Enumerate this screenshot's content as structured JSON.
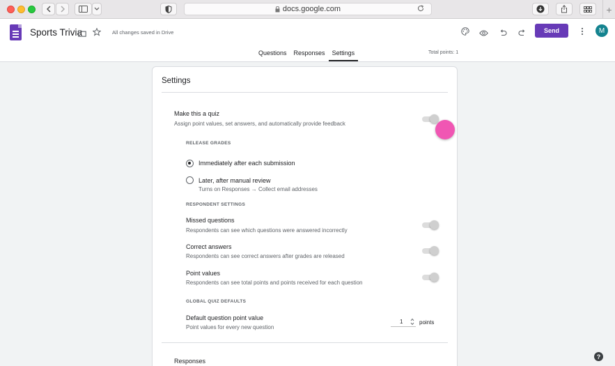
{
  "browser": {
    "url": "docs.google.com"
  },
  "app": {
    "title": "Sports Trivia",
    "saved_status": "All changes saved in Drive",
    "send_label": "Send",
    "avatar_initial": "M",
    "tabs": [
      {
        "label": "Questions"
      },
      {
        "label": "Responses"
      },
      {
        "label": "Settings"
      }
    ],
    "total_points": "Total points: 1"
  },
  "settings": {
    "title": "Settings",
    "quiz": {
      "label": "Make this a quiz",
      "desc": "Assign point values, set answers, and automatically provide feedback"
    },
    "release_grades": {
      "heading": "RELEASE GRADES",
      "options": [
        {
          "label": "Immediately after each submission",
          "selected": true
        },
        {
          "label": "Later, after manual review",
          "desc": "Turns on Responses → Collect email addresses",
          "selected": false
        }
      ]
    },
    "respondent_settings": {
      "heading": "RESPONDENT SETTINGS",
      "items": [
        {
          "label": "Missed questions",
          "desc": "Respondents can see which questions were answered incorrectly"
        },
        {
          "label": "Correct answers",
          "desc": "Respondents can see correct answers after grades are released"
        },
        {
          "label": "Point values",
          "desc": "Respondents can see total points and points received for each question"
        }
      ]
    },
    "global_defaults": {
      "heading": "GLOBAL QUIZ DEFAULTS",
      "point_label": "Default question point value",
      "point_desc": "Point values for every new question",
      "point_value": "1",
      "points_unit": "points"
    },
    "next_section": "Responses"
  },
  "help": "?",
  "accent_color": "#673ab7"
}
